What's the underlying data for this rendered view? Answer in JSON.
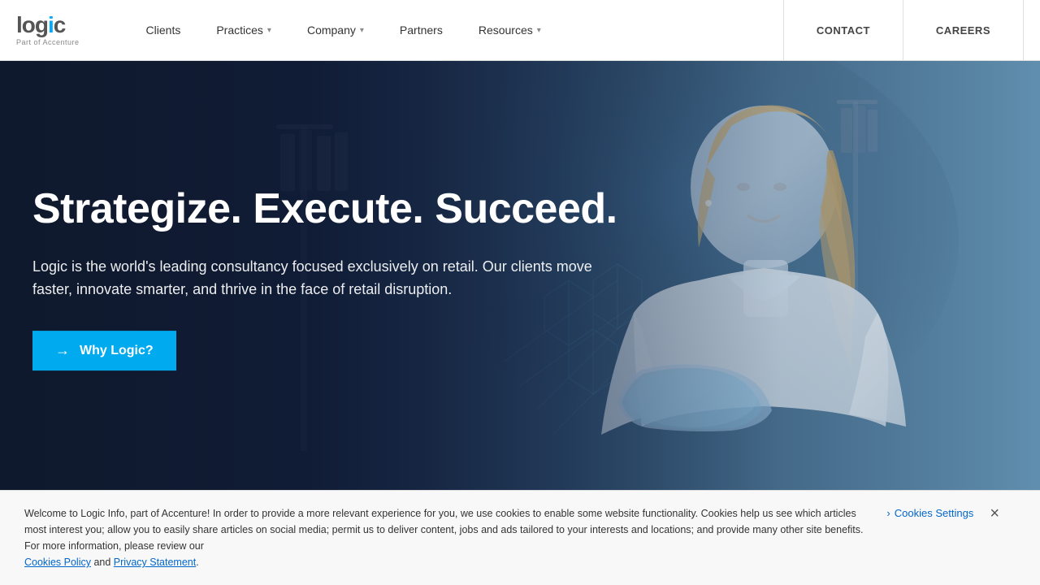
{
  "header": {
    "logo": {
      "main": "logic",
      "highlight_letter": "i",
      "subtitle": "Part of Accenture"
    },
    "nav": [
      {
        "label": "Clients",
        "has_dropdown": false
      },
      {
        "label": "Practices",
        "has_dropdown": true
      },
      {
        "label": "Company",
        "has_dropdown": true
      },
      {
        "label": "Partners",
        "has_dropdown": false
      },
      {
        "label": "Resources",
        "has_dropdown": true
      }
    ],
    "buttons": [
      {
        "label": "CONTACT",
        "id": "contact-btn"
      },
      {
        "label": "CAREERS",
        "id": "careers-btn"
      }
    ]
  },
  "hero": {
    "title": "Strategize. Execute. Succeed.",
    "description": "Logic is the world's leading consultancy focused exclusively on retail. Our clients move faster, innovate smarter, and thrive in the face of retail disruption.",
    "cta_label": "Why Logic?",
    "cta_arrow": "→"
  },
  "cookie_banner": {
    "text_before_settings": "Welcome to Logic Info, part of Accenture! In order to provide a more relevant experience for you, we use cookies to enable some website functionality. Cookies help us see which articles most interest you; allow you to easily share articles on social media; permit us to deliver content, jobs and ads tailored to your interests and locations; and provide many other site benefits. For more information, please review our",
    "link1_label": "Cookies Policy",
    "link1_separator": " and ",
    "link2_label": "Privacy Statement",
    "text_after": ".",
    "settings_chevron": "›",
    "settings_label": "Cookies Settings",
    "close_icon": "×"
  }
}
